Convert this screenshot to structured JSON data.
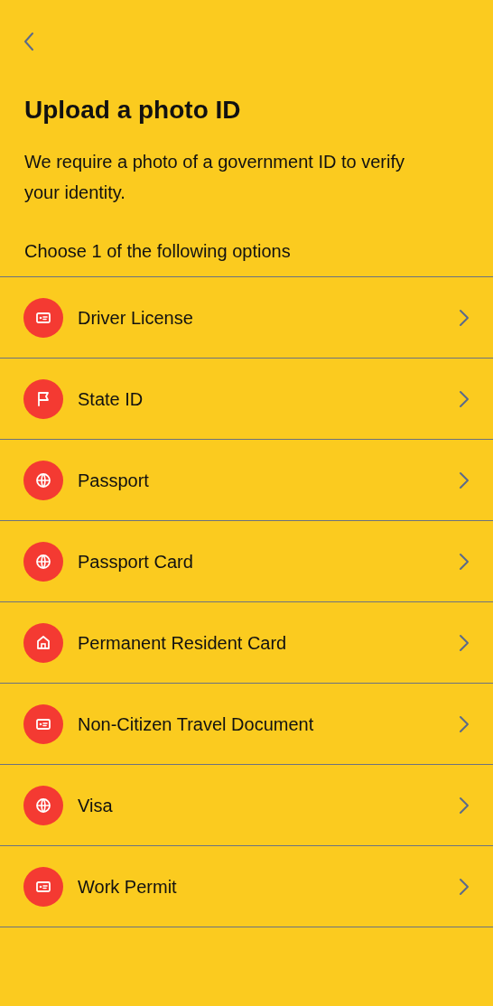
{
  "title": "Upload a photo ID",
  "description": "We require a photo of a government ID to verify your identity.",
  "prompt": "Choose 1 of the following options",
  "options": [
    {
      "label": "Driver License",
      "kind": "card"
    },
    {
      "label": "State ID",
      "kind": "flag"
    },
    {
      "label": "Passport",
      "kind": "globe"
    },
    {
      "label": "Passport Card",
      "kind": "globe"
    },
    {
      "label": "Permanent Resident Card",
      "kind": "home"
    },
    {
      "label": "Non-Citizen Travel Document",
      "kind": "card"
    },
    {
      "label": "Visa",
      "kind": "globe"
    },
    {
      "label": "Work Permit",
      "kind": "card"
    }
  ]
}
